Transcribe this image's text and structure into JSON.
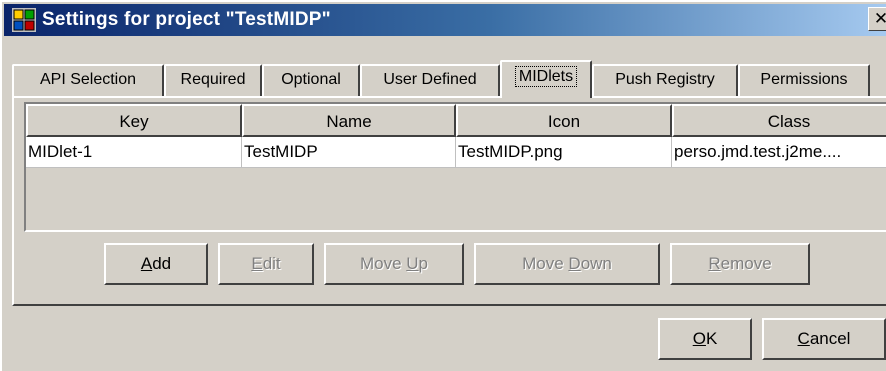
{
  "window": {
    "title": "Settings for project \"TestMIDP\"",
    "close": "✕"
  },
  "tabs": [
    {
      "label": "API Selection"
    },
    {
      "label": "Required"
    },
    {
      "label": "Optional"
    },
    {
      "label": "User Defined"
    },
    {
      "label": "MIDlets",
      "active": true
    },
    {
      "label": "Push Registry"
    },
    {
      "label": "Permissions"
    }
  ],
  "table": {
    "columns": [
      "Key",
      "Name",
      "Icon",
      "Class"
    ],
    "rows": [
      [
        "MIDlet-1",
        "TestMIDP",
        "TestMIDP.png",
        "perso.jmd.test.j2me...."
      ]
    ]
  },
  "buttons": {
    "add": {
      "mnemonic": "A",
      "rest": "dd",
      "enabled": true
    },
    "edit": {
      "mnemonic": "E",
      "rest": "dit",
      "enabled": false
    },
    "move_up": {
      "pre": "Move ",
      "mnemonic": "U",
      "rest": "p",
      "enabled": false
    },
    "move_down": {
      "pre": "Move ",
      "mnemonic": "D",
      "rest": "own",
      "enabled": false
    },
    "remove": {
      "mnemonic": "R",
      "rest": "emove",
      "enabled": false
    },
    "ok": {
      "mnemonic": "O",
      "rest": "K",
      "enabled": true
    },
    "cancel": {
      "mnemonic": "C",
      "rest": "ancel",
      "enabled": true
    }
  }
}
